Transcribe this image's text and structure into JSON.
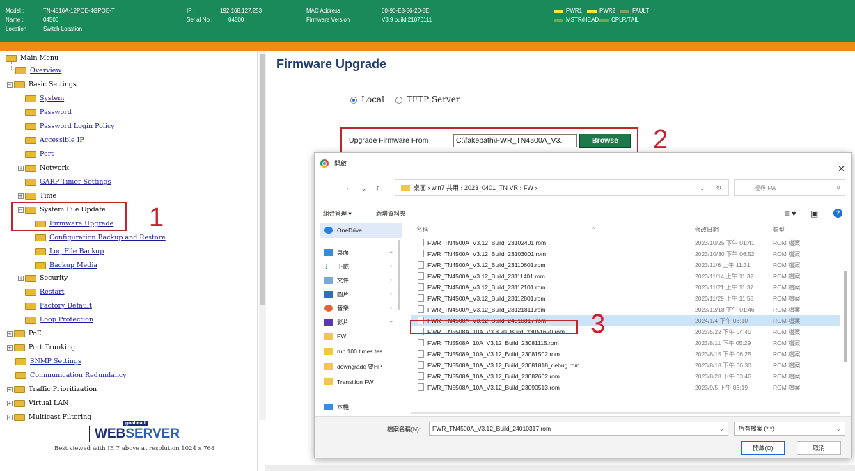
{
  "header": {
    "model_label": "Model :",
    "model_value": "TN-4516A-12POE-4GPOE-T",
    "name_label": "Name :",
    "name_value": "04500",
    "location_label": "Location :",
    "location_value": "Switch Location",
    "ip_label": "IP :",
    "ip_value": "192.168.127.253",
    "serial_label": "Serial No :",
    "serial_value": "04500",
    "mac_label": "MAC Address :",
    "mac_value": "00-90-E8-56-20-8E",
    "fw_label": "Firmware Version :",
    "fw_value": "V3.9 build 21070111",
    "leds": [
      "PWR1",
      "PWR2",
      "FAULT",
      "MSTR/HEAD",
      "CPLR/TAIL"
    ]
  },
  "tree": {
    "main_menu": "Main Menu",
    "overview": "Overview",
    "basic_settings": "Basic Settings",
    "system": "System",
    "password": "Password",
    "password_login_policy": "Password Login Policy",
    "accessible_ip": "Accessible IP",
    "port": "Port",
    "network": "Network",
    "garp": "GARP Timer Settings",
    "time": "Time",
    "system_file_update": "System File Update",
    "firmware_upgrade": "Firmware Upgrade",
    "config_backup": "Configuration Backup and Restore",
    "log_backup": "Log File Backup",
    "backup_media": "Backup Media",
    "security": "Security",
    "restart": "Restart",
    "factory_default": "Factory Default",
    "loop_protection": "Loop Protection",
    "poe": "PoE",
    "port_trunking": "Port Trunking",
    "snmp": "SNMP Settings",
    "comm_redundancy": "Communication Redundancy",
    "traffic": "Traffic Prioritization",
    "vlan": "Virtual LAN",
    "multicast": "Multicast Filtering"
  },
  "footer": {
    "goahead": "goahead",
    "web": "WEB",
    "server": "SERVER",
    "best_viewed": "Best viewed with IE 7 above at resolution 1024 x 768"
  },
  "panel": {
    "title": "Firmware Upgrade",
    "radio_local": "Local",
    "radio_tftp": "TFTP Server",
    "upgrade_from_label": "Upgrade Firmware From",
    "file_path": "C:\\fakepath\\FWR_TN4500A_V3.",
    "browse": "Browse"
  },
  "steps": [
    "1",
    "2",
    "3"
  ],
  "dialog": {
    "title": "開啟",
    "breadcrumb": "桌面  ›  win7 共用  ›  2023_0401_TN VR  ›  FW  ›",
    "search_placeholder": "搜尋 FW",
    "organize": "組合管理 ▾",
    "new_folder": "新增資料夾",
    "col_name": "名稱",
    "col_date": "修改日期",
    "col_type": "類型",
    "sidebar": [
      {
        "label": "OneDrive",
        "pinned": false
      },
      {
        "label": "桌面",
        "pinned": true
      },
      {
        "label": "下載",
        "pinned": true
      },
      {
        "label": "文件",
        "pinned": true
      },
      {
        "label": "圖片",
        "pinned": true
      },
      {
        "label": "音樂",
        "pinned": true
      },
      {
        "label": "影片",
        "pinned": true
      },
      {
        "label": "FW",
        "pinned": false
      },
      {
        "label": "run 100 times tes",
        "pinned": false
      },
      {
        "label": "downgrade 要HP",
        "pinned": false
      },
      {
        "label": "Transition FW",
        "pinned": false
      },
      {
        "label": "本機",
        "pinned": false
      }
    ],
    "files": [
      {
        "name": "FWR_TN4500A_V3.12_Build_23102401.rom",
        "date": "2023/10/25 下午 01:41",
        "type": "ROM 檔案"
      },
      {
        "name": "FWR_TN4500A_V3.12_Build_23103001.rom",
        "date": "2023/10/30 下午 06:52",
        "type": "ROM 檔案"
      },
      {
        "name": "FWR_TN4500A_V3.12_Build_23110601.rom",
        "date": "2023/11/6 上午 11:31",
        "type": "ROM 檔案"
      },
      {
        "name": "FWR_TN4500A_V3.12_Build_23111401.rom",
        "date": "2023/11/14 上午 11:32",
        "type": "ROM 檔案"
      },
      {
        "name": "FWR_TN4500A_V3.12_Build_23112101.rom",
        "date": "2023/11/21 上午 11:37",
        "type": "ROM 檔案"
      },
      {
        "name": "FWR_TN4500A_V3.12_Build_23112801.rom",
        "date": "2023/11/29 上午 11:58",
        "type": "ROM 檔案"
      },
      {
        "name": "FWR_TN4500A_V3.12_Build_23121811.rom",
        "date": "2023/12/18 下午 01:46",
        "type": "ROM 檔案"
      },
      {
        "name": "FWR_TN4500A_V3.12_Build_24010317.rom",
        "date": "2024/1/4 下午 06:10",
        "type": "ROM 檔案"
      },
      {
        "name": "FWR_TN5508A_10A_V3.8.20_Build_23051620.rom",
        "date": "2023/5/22 下午 04:40",
        "type": "ROM 檔案"
      },
      {
        "name": "FWR_TN5508A_10A_V3.12_Build_23081115.rom",
        "date": "2023/8/11 下午 05:29",
        "type": "ROM 檔案"
      },
      {
        "name": "FWR_TN5508A_10A_V3.12_Build_23081502.rom",
        "date": "2023/8/15 下午 06:25",
        "type": "ROM 檔案"
      },
      {
        "name": "FWR_TN5508A_10A_V3.12_Build_23081818_debug.rom",
        "date": "2023/8/18 下午 06:30",
        "type": "ROM 檔案"
      },
      {
        "name": "FWR_TN5508A_10A_V3.12_Build_23082602.rom",
        "date": "2023/8/28 下午 03:46",
        "type": "ROM 檔案"
      },
      {
        "name": "FWR_TN5508A_10A_V3.12_Build_23090513.rom",
        "date": "2023/9/5 下午 06:19",
        "type": "ROM 檔案"
      }
    ],
    "filename_label": "檔案名稱(N):",
    "filename_value": "FWR_TN4500A_V3.12_Build_24010317.rom",
    "filetype_value": "所有檔案 (*.*)",
    "open": "開啟(O)",
    "cancel": "取消"
  }
}
